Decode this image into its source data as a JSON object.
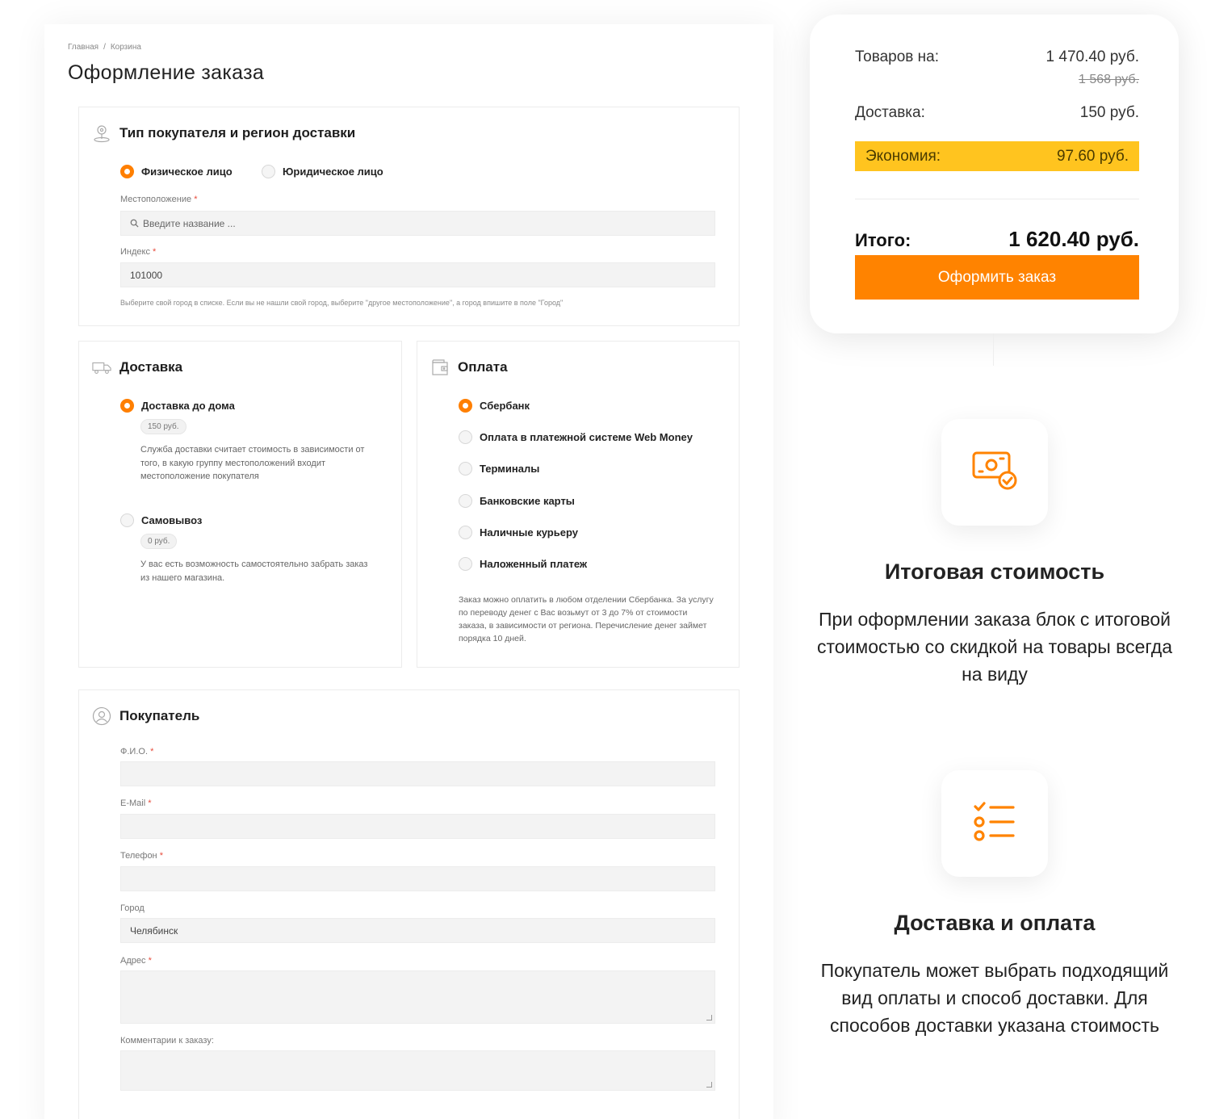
{
  "breadcrumb": {
    "home": "Главная",
    "separator": "/",
    "current": "Корзина"
  },
  "page_title": "Оформление заказа",
  "buyer_region": {
    "title": "Тип покупателя и регион доставки",
    "types": [
      {
        "label": "Физическое лицо",
        "selected": true
      },
      {
        "label": "Юридическое лицо",
        "selected": false
      }
    ],
    "location_label": "Местоположение",
    "location_placeholder": "Введите название ...",
    "index_label": "Индекс",
    "index_value": "101000",
    "required_mark": "*",
    "hint": "Выберите свой город в списке. Если вы не нашли свой город, выберите \"другое местоположение\", а город впишите в поле \"Город\""
  },
  "delivery": {
    "title": "Доставка",
    "options": [
      {
        "label": "Доставка до дома",
        "price": "150 руб.",
        "description": "Служба доставки считает стоимость в зависимости от того, в какую группу местоположений входит местоположение покупателя",
        "selected": true
      },
      {
        "label": "Самовывоз",
        "price": "0 руб.",
        "description": "У вас есть возможность самостоятельно забрать заказ из нашего магазина.",
        "selected": false
      }
    ]
  },
  "payment": {
    "title": "Оплата",
    "options": [
      {
        "label": "Сбербанк",
        "selected": true
      },
      {
        "label": "Оплата в платежной системе Web Money",
        "selected": false
      },
      {
        "label": "Терминалы",
        "selected": false
      },
      {
        "label": "Банковские карты",
        "selected": false
      },
      {
        "label": "Наличные курьеру",
        "selected": false
      },
      {
        "label": "Наложенный платеж",
        "selected": false
      }
    ],
    "description": "Заказ можно оплатить в любом отделении Сбербанка. За услугу по переводу денег с Вас возьмут от 3 до 7% от стоимости заказа, в зависимости от региона. Перечисление денег займет порядка 10 дней."
  },
  "buyer": {
    "title": "Покупатель",
    "fields": {
      "fio": {
        "label": "Ф.И.О.",
        "value": ""
      },
      "email": {
        "label": "E-Mail",
        "value": ""
      },
      "phone": {
        "label": "Телефон",
        "value": ""
      },
      "city": {
        "label": "Город",
        "value": "Челябинск"
      },
      "address": {
        "label": "Адрес",
        "value": ""
      },
      "comment": {
        "label": "Комментарии к заказу:",
        "value": ""
      }
    }
  },
  "summary": {
    "goods_label": "Товаров на:",
    "goods_value": "1 470.40 руб.",
    "goods_old_value": "1 568 руб.",
    "delivery_label": "Доставка:",
    "delivery_value": "150 руб.",
    "economy_label": "Экономия:",
    "economy_value": "97.60 руб.",
    "total_label": "Итого:",
    "total_value": "1 620.40 руб.",
    "order_button": "Оформить заказ"
  },
  "features": [
    {
      "title": "Итоговая стоимость",
      "text": "При оформлении заказа блок с итоговой стоимостью со скидкой на товары всегда на виду"
    },
    {
      "title": "Доставка и оплата",
      "text": "Покупатель может выбрать подходящий вид оплаты и способ доставки. Для способов доставки указана стоимость"
    }
  ],
  "colors": {
    "accent": "#ff8300",
    "economy": "#ffc41f",
    "text": "#222222"
  }
}
